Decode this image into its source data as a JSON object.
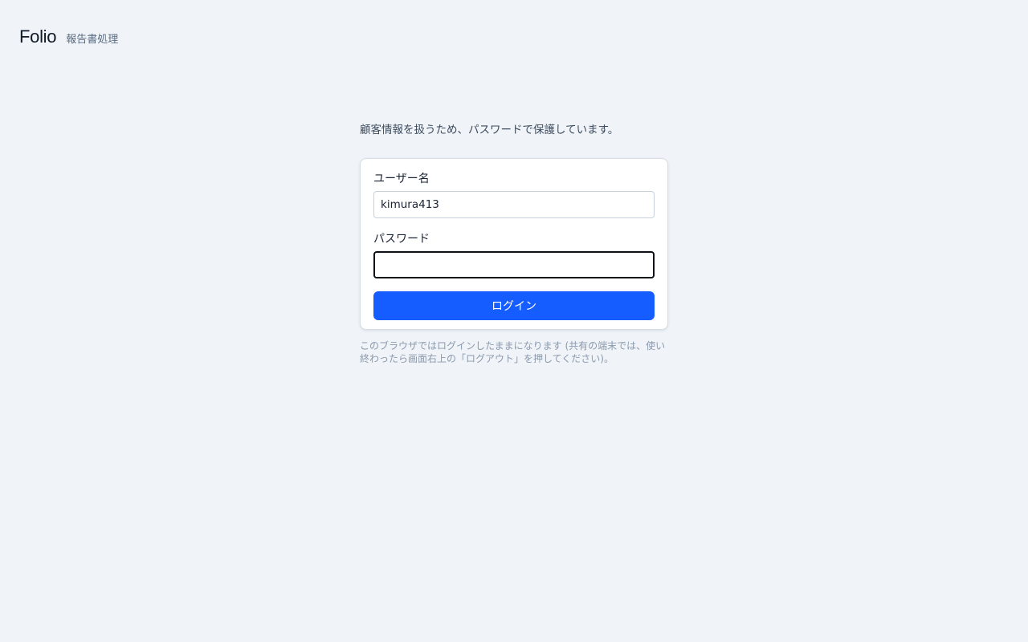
{
  "header": {
    "brand": "Folio",
    "subtitle": "報告書処理"
  },
  "login": {
    "notice": "顧客情報を扱うため、パスワードで保護しています。",
    "username_label": "ユーザー名",
    "username_value": "kimura413",
    "password_label": "パスワード",
    "password_value": "",
    "submit_label": "ログイン",
    "footnote": "このブラウザではログインしたままになります (共有の端末では、使い終わったら画面右上の「ログアウト」を押してください)。"
  },
  "colors": {
    "background": "#f0f4f8",
    "accent": "#165dff",
    "card": "#ffffff"
  }
}
